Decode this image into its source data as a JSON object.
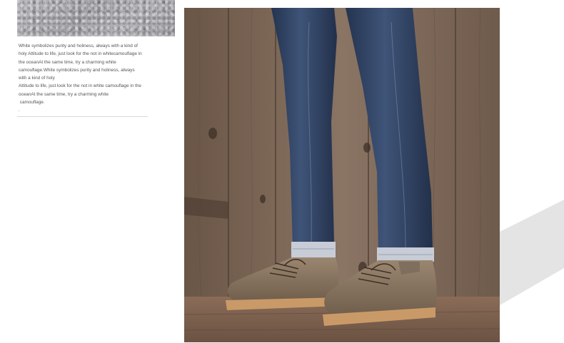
{
  "description": {
    "lines": [
      "White symbolizes purity and holiness, always with a kind of",
      "holy Attitude to life, just look for the not in whitecamouflage in",
      "the oceanAt the same time, try a charming white",
      "camouflage.White symbolizes purity and holiness, always",
      "with a kind of holy",
      "Attitude to life, just look for the not in white camouflage in the",
      "oceanAt the same time, try a charming white",
      " camouflage.",
      "."
    ]
  },
  "colors": {
    "background": "#ffffff",
    "text": "#555555",
    "swatch": "#a9a9ae",
    "denim": "#2f3f5e",
    "suede": "#8a7560",
    "sole": "#c79a6a",
    "wood": "#7a6352",
    "decor_gray": "#e4e4e4"
  }
}
